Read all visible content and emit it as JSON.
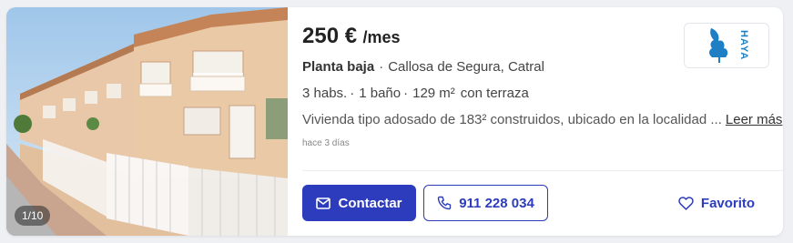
{
  "listing": {
    "image_counter": "1/10",
    "price": "250 €",
    "price_period": "/mes",
    "property_type": "Planta baja",
    "location_separator": "·",
    "location": "Callosa de Segura, Catral",
    "features": {
      "rooms": "3 habs.",
      "baths": "1 baño",
      "area": "129 m²",
      "extra": "con terraza",
      "separator": "·"
    },
    "description": "Vivienda tipo adosado de 183² construidos, ubicado en la localidad ...",
    "read_more": "Leer más",
    "published": "hace 3 días",
    "agency_logo": {
      "text": "HAYA",
      "color": "#1e7fc4",
      "icon": "tree-icon"
    }
  },
  "actions": {
    "contact_label": "Contactar",
    "contact_icon": "mail-icon",
    "phone_label": "911 228 034",
    "phone_icon": "phone-icon",
    "favorite_label": "Favorito",
    "favorite_icon": "heart-icon"
  },
  "colors": {
    "primary": "#2c3cbd",
    "card_bg": "#ffffff",
    "page_bg": "#eef0f3"
  }
}
